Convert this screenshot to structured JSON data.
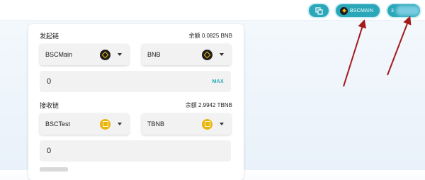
{
  "header": {
    "chain_button_label": "BSCMAIN",
    "account_button_label": "3"
  },
  "from": {
    "label": "发起链",
    "balance": "余额 0.0825 BNB",
    "chain": "BSCMain",
    "token": "BNB",
    "amount": "0",
    "max_label": "MAX"
  },
  "to": {
    "label": "接收链",
    "balance": "余额 2.9942 TBNB",
    "chain": "BSCTest",
    "token": "TBNB",
    "amount": "0"
  },
  "colors": {
    "accent": "#2aa7b9",
    "annotation_arrow": "#a31a1a",
    "bnb_gold": "#f0b90b"
  },
  "icons": [
    "swap-icon",
    "bnb-logo-icon",
    "tbnb-logo-icon",
    "chevron-down-icon"
  ]
}
